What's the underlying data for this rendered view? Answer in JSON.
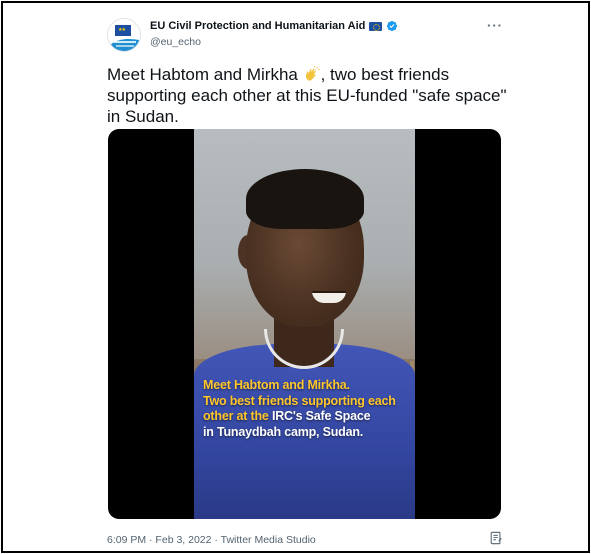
{
  "account": {
    "name": "EU Civil Protection and Humanitarian Aid",
    "handle": "@eu_echo",
    "flag_icon": "eu-flag-icon",
    "verified_icon": "verified-badge-icon"
  },
  "more_label": "···",
  "tweet": {
    "text_before_emoji": "Meet Habtom and Mirkha ",
    "emoji": "clapping-hands-icon",
    "text_after_emoji": ", two best friends supporting each other at this EU-funded \"safe space\" in Sudan."
  },
  "media": {
    "caption_line1": "Meet Habtom and Mirkha.",
    "caption_line2": "Two best friends supporting each",
    "caption_line3_a": "other at the ",
    "caption_line3_b": "IRC's Safe Space",
    "caption_line4": "in Tunaydbah camp, Sudan."
  },
  "footer": {
    "meta": "6:09 PM · Feb 3, 2022 · Twitter Media Studio",
    "note_icon": "note-icon"
  },
  "colors": {
    "caption_yellow": "#ffc72c",
    "verified_blue": "#1d9bf0",
    "eu_blue": "#1c4fa1"
  }
}
